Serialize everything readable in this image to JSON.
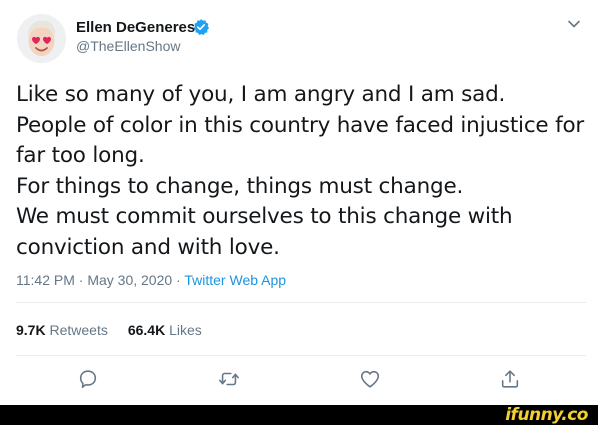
{
  "user": {
    "name": "Ellen DeGeneres",
    "handle": "@TheEllenShow",
    "avatar_icon": "heart-eyes-emoji-avatar",
    "verified_icon": "verified-badge-icon"
  },
  "tweet": {
    "lines": [
      "Like so many of you, I am angry and I am sad.",
      "People of color in this country have faced injustice for",
      "far too long.",
      "For things to change, things must change.",
      "We must commit ourselves to this change with",
      "conviction and with love."
    ],
    "timestamp": "11:42 PM · May 30, 2020 · ",
    "source": "Twitter Web App"
  },
  "stats": {
    "retweets_count": "9.7K",
    "retweets_label": "Retweets",
    "likes_count": "66.4K",
    "likes_label": "Likes"
  },
  "actions": [
    "reply-icon",
    "retweet-icon",
    "like-icon",
    "share-icon"
  ],
  "watermark": "ifunny.co",
  "colors": {
    "text": "#14171a",
    "secondary": "#657786",
    "link": "#1b95e0",
    "verified": "#1da1f2",
    "watermark": "#f2d033"
  }
}
